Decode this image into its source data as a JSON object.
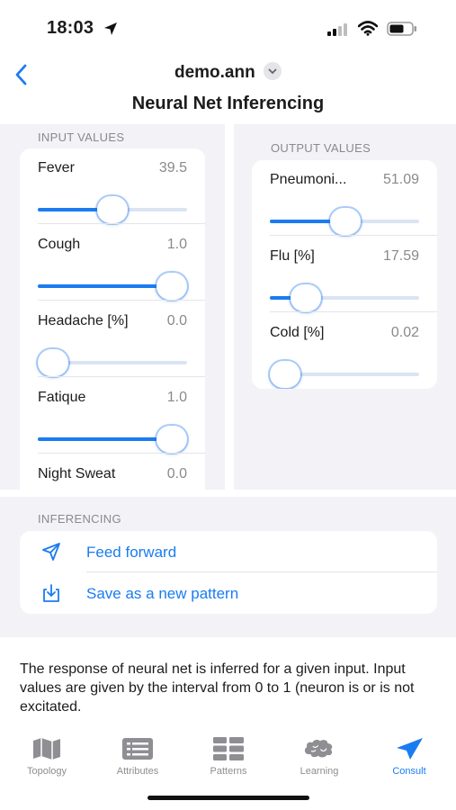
{
  "status": {
    "time": "18:03"
  },
  "nav": {
    "doc_title": "demo.ann",
    "page_title": "Neural Net Inferencing"
  },
  "inputs": {
    "header": "INPUT VALUES",
    "items": [
      {
        "label": "Fever",
        "value": "39.5",
        "level": 0.5
      },
      {
        "label": "Cough",
        "value": "1.0",
        "level": 1.0
      },
      {
        "label": "Headache [%]",
        "value": "0.0",
        "level": 0.0
      },
      {
        "label": "Fatique",
        "value": "1.0",
        "level": 1.0
      },
      {
        "label": "Night Sweat",
        "value": "0.0",
        "level": 0.0
      }
    ]
  },
  "outputs": {
    "header": "OUTPUT VALUES",
    "items": [
      {
        "label": "Pneumoni...",
        "value": "51.09",
        "level": 0.5109
      },
      {
        "label": "Flu [%]",
        "value": "17.59",
        "level": 0.1759
      },
      {
        "label": "Cold [%]",
        "value": "0.02",
        "level": 0.0002
      }
    ]
  },
  "inferencing": {
    "header": "INFERENCING",
    "actions": [
      {
        "label": "Feed forward",
        "icon": "send-icon"
      },
      {
        "label": "Save as a new pattern",
        "icon": "download-tray-icon"
      }
    ]
  },
  "description": "The response of neural net is inferred for a given input. Input values are given by the interval from 0 to 1 (neuron is or is not excitated.",
  "tabs": [
    {
      "label": "Topology",
      "icon": "map-icon"
    },
    {
      "label": "Attributes",
      "icon": "list-icon"
    },
    {
      "label": "Patterns",
      "icon": "grid-icon"
    },
    {
      "label": "Learning",
      "icon": "brain-icon"
    },
    {
      "label": "Consult",
      "icon": "send-icon"
    }
  ],
  "active_tab": "Consult",
  "colors": {
    "accent": "#1a7cf0",
    "grouped_bg": "#f2f2f7",
    "secondary_text": "#8a8a8e"
  }
}
